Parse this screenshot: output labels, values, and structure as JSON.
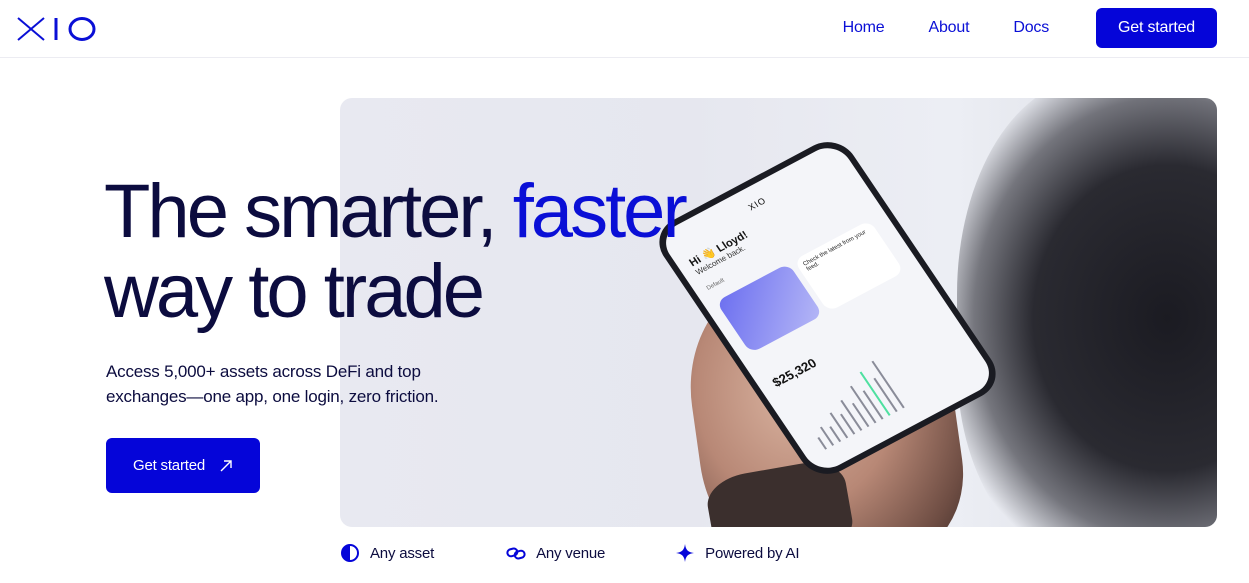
{
  "brand": {
    "logo_text": "XIO",
    "accent": "#0505d9"
  },
  "nav": {
    "links": [
      "Home",
      "About",
      "Docs"
    ],
    "cta_label": "Get started"
  },
  "hero": {
    "headline_line1_a": "The smarter, ",
    "headline_line1_b": "faster",
    "headline_line2": "way to trade",
    "subheading": "Access 5,000+ assets across DeFi and top exchanges—one app, one login, zero friction.",
    "cta_label": "Get started"
  },
  "phone": {
    "logo": "XIO",
    "greeting": "Hi 👋 Lloyd!",
    "welcome": "Welcome back.",
    "tab": "Default",
    "card_text": "Check the latest from your feed.",
    "price": "$25,320"
  },
  "features": [
    {
      "icon": "contrast-icon",
      "label": "Any asset"
    },
    {
      "icon": "link-icon",
      "label": "Any venue"
    },
    {
      "icon": "sparkle-icon",
      "label": "Powered by AI"
    }
  ]
}
